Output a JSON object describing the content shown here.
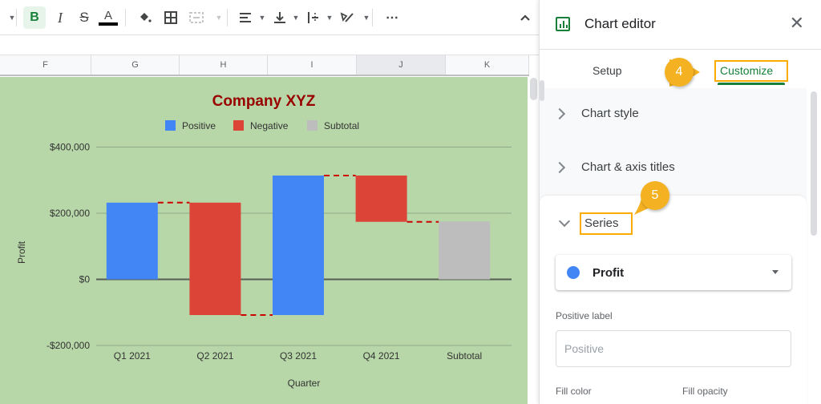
{
  "toolbar": {
    "bold_label": "B",
    "italic_label": "I",
    "strike_label": "S",
    "text_color_label": "A",
    "more_label": "⋯",
    "collapse_label": "^"
  },
  "columns": [
    {
      "label": "F",
      "selected": false
    },
    {
      "label": "G",
      "selected": false
    },
    {
      "label": "H",
      "selected": false
    },
    {
      "label": "I",
      "selected": false
    },
    {
      "label": "J",
      "selected": true
    },
    {
      "label": "K",
      "selected": false
    }
  ],
  "chart_data": {
    "type": "bar",
    "subtype": "waterfall",
    "title": "Company XYZ",
    "title_color": "#990000",
    "background": "#b7d7a8",
    "xlabel": "Quarter",
    "ylabel": "Profit",
    "categories": [
      "Q1 2021",
      "Q2 2021",
      "Q3 2021",
      "Q4 2021",
      "Subtotal"
    ],
    "changes": [
      232000,
      -340000,
      422000,
      -140000,
      175000
    ],
    "kinds": [
      "positive",
      "negative",
      "positive",
      "negative",
      "subtotal"
    ],
    "ylim": [
      -200000,
      400000
    ],
    "yticks": [
      400000,
      200000,
      0,
      -200000
    ],
    "ytick_labels": [
      "$400,000",
      "$200,000",
      "$0",
      "-$200,000"
    ],
    "grid": true,
    "connector_lines": "dashed",
    "legend": {
      "position": "top",
      "entries": [
        {
          "label": "Positive",
          "color": "#4285f4"
        },
        {
          "label": "Negative",
          "color": "#db4437"
        },
        {
          "label": "Subtotal",
          "color": "#bdbdbd"
        }
      ]
    },
    "colors": {
      "positive": "#4285f4",
      "negative": "#db4437",
      "subtotal": "#bdbdbd",
      "connector": "#cc0000"
    }
  },
  "panel": {
    "title": "Chart editor",
    "tabs": [
      {
        "label": "Setup",
        "active": false
      },
      {
        "label": "Customize",
        "active": true
      }
    ],
    "sections": [
      {
        "label": "Chart style",
        "expanded": false
      },
      {
        "label": "Chart & axis titles",
        "expanded": false
      },
      {
        "label": "Series",
        "expanded": true
      }
    ],
    "series_dropdown": {
      "value": "Profit",
      "color": "#4285f4"
    },
    "positive_label": {
      "label": "Positive label",
      "value": "",
      "placeholder": "Positive"
    },
    "fill_color_label": "Fill color",
    "fill_opacity_label": "Fill opacity"
  },
  "callouts": [
    {
      "number": "4",
      "target": "Customize"
    },
    {
      "number": "5",
      "target": "Series"
    }
  ],
  "accent_colors": {
    "green": "#188038",
    "callout": "#f4b223",
    "highlight": "#f9ab00"
  }
}
